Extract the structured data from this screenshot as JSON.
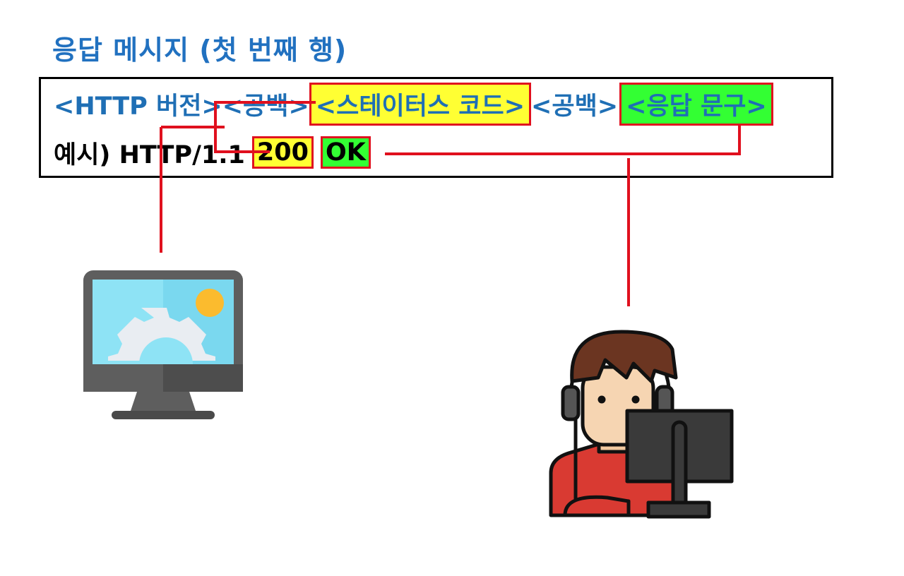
{
  "title": "응답 메시지 (첫 번째 행)",
  "format_line": {
    "version": "<HTTP 버전>",
    "space1": "<공백>",
    "status_code": "<스테이터스 코드>",
    "space2": "<공백>",
    "reason_phrase": "<응답 문구>"
  },
  "example_line": {
    "prefix": "예시) HTTP/1.1",
    "code": "200",
    "phrase": "OK"
  },
  "colors": {
    "title": "#2171c0",
    "highlight_yellow": "#ffff33",
    "highlight_green": "#33ff33",
    "connector_red": "#e0101e"
  },
  "icons": [
    "server-monitor-icon",
    "developer-at-computer-icon"
  ]
}
